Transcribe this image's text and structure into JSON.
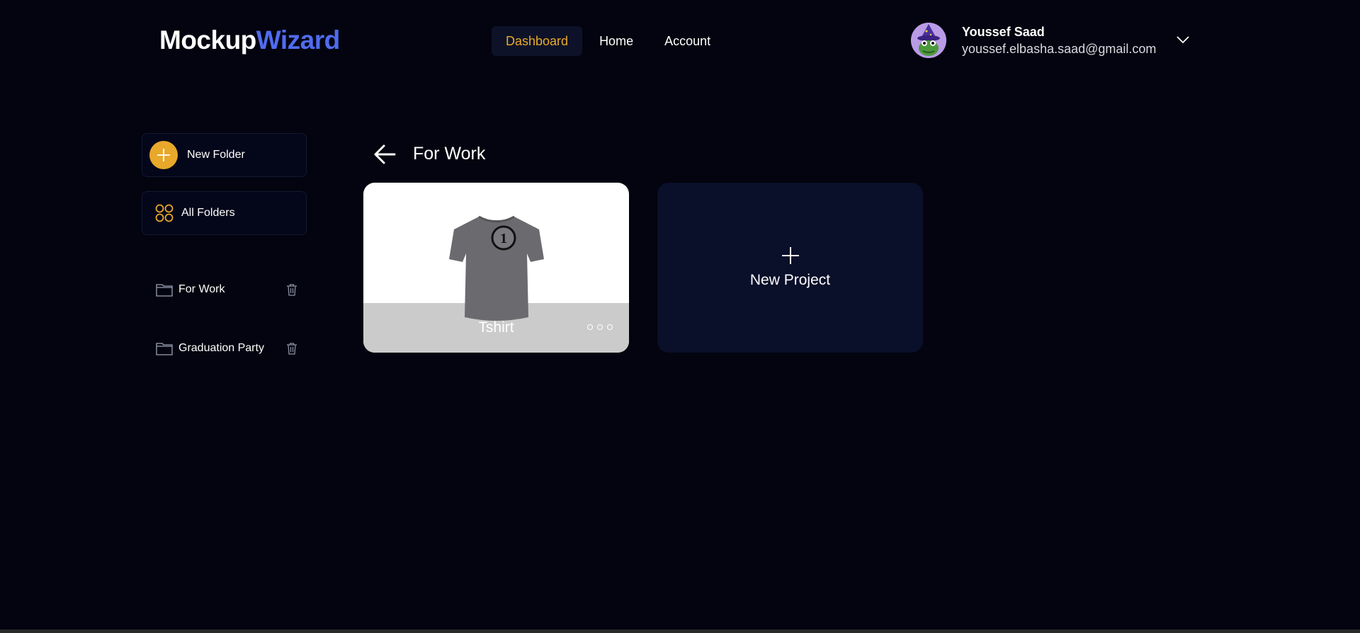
{
  "brand": {
    "part1": "Mockup",
    "part2": "Wizard",
    "accent": "#4f6cf0"
  },
  "nav": {
    "items": [
      {
        "label": "Dashboard",
        "active": true
      },
      {
        "label": "Home",
        "active": false
      },
      {
        "label": "Account",
        "active": false
      }
    ],
    "active_color": "#e9a92a"
  },
  "user": {
    "name": "Youssef Saad",
    "email": "youssef.elbasha.saad@gmail.com",
    "avatar_icon": "wizard-frog-avatar",
    "menu_icon": "chevron-down-icon"
  },
  "sidebar": {
    "new_folder_label": "New Folder",
    "all_folders_label": "All Folders",
    "folders": [
      {
        "name": "For Work",
        "icon": "folder-icon",
        "delete_icon": "trash-icon"
      },
      {
        "name": "Graduation Party",
        "icon": "folder-icon",
        "delete_icon": "trash-icon"
      }
    ]
  },
  "main": {
    "folder_title": "For Work",
    "back_icon": "arrow-left-icon",
    "projects": [
      {
        "name": "Tshirt",
        "thumbnail_icon": "tshirt-icon",
        "menu_icon": "more-dots-icon"
      }
    ],
    "new_project_label": "New Project"
  },
  "colors": {
    "background": "#03040f",
    "accent_orange": "#e8a82a",
    "card_dark": "#0a0f2a"
  }
}
